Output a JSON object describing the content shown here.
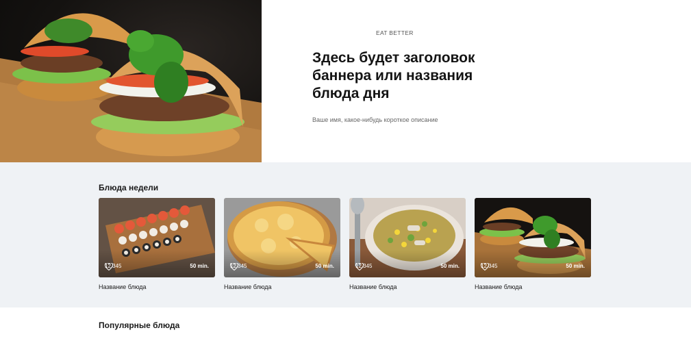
{
  "hero": {
    "eyebrow": "EAT BETTER",
    "title": "Здесь будет заголовок баннера или названия блюда дня",
    "description": "Ваше имя, какое-нибудь короткое описание",
    "image_icon": "burger-photo"
  },
  "week_dishes": {
    "title": "Блюда недели",
    "cards": [
      {
        "image": "sushi-photo",
        "likes": "12 345",
        "time": "50 min.",
        "name": "Название блюда"
      },
      {
        "image": "pizza-photo",
        "likes": "12 345",
        "time": "50 min.",
        "name": "Название блюда"
      },
      {
        "image": "soup-photo",
        "likes": "12 345",
        "time": "50 min.",
        "name": "Название блюда"
      },
      {
        "image": "burger-photo",
        "likes": "12 345",
        "time": "50 min.",
        "name": "Название блюда"
      }
    ]
  },
  "popular_dishes": {
    "title": "Популярные блюда"
  },
  "colors": {
    "section_bg": "#eff2f5",
    "text": "#141414"
  }
}
